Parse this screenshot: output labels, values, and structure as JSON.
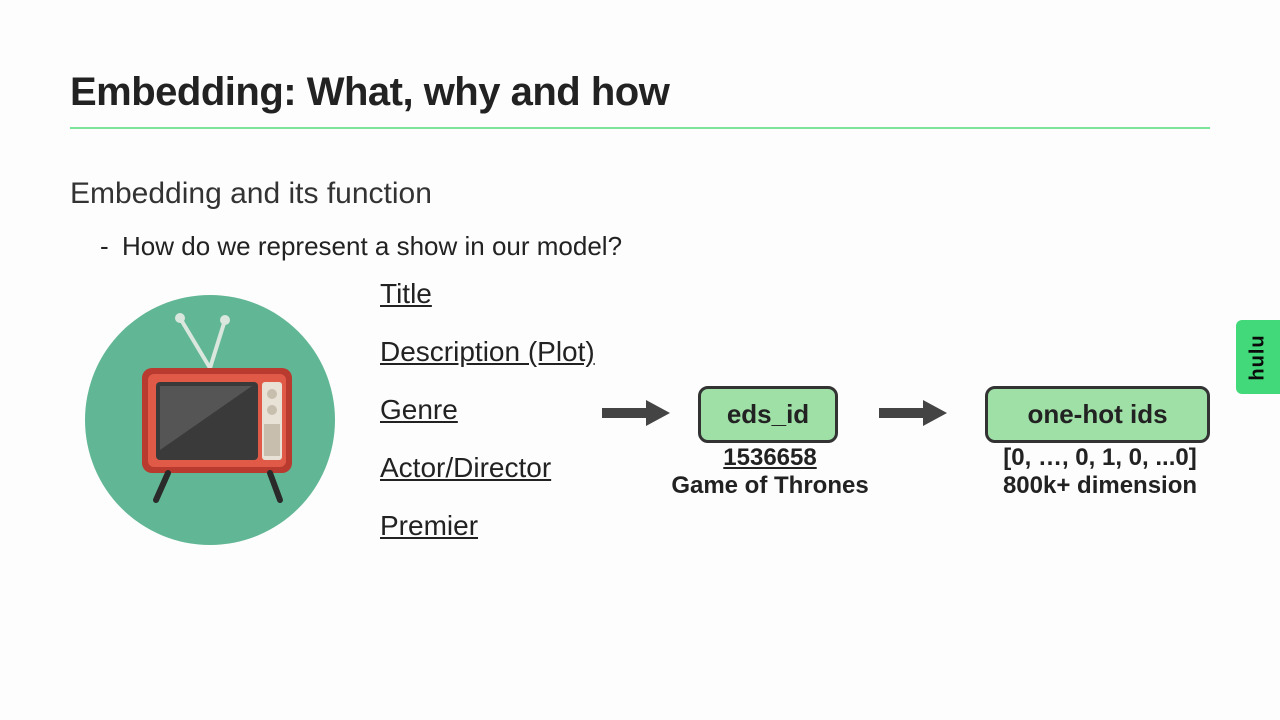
{
  "title": "Embedding: What, why and how",
  "subhead": "Embedding and its function",
  "bullet": "How do we represent a show in our model?",
  "attributes": {
    "a0": "Title",
    "a1": "Description (Plot)",
    "a2": "Genre",
    "a3": "Actor/Director",
    "a4": "Premier"
  },
  "box1": {
    "label": "eds_id",
    "id": "1536658",
    "name": "Game of Thrones"
  },
  "box2": {
    "label": "one-hot ids",
    "vec": "[0, …, 0, 1, 0, ...0]",
    "dim": "800k+ dimension"
  },
  "brand": "hulu"
}
